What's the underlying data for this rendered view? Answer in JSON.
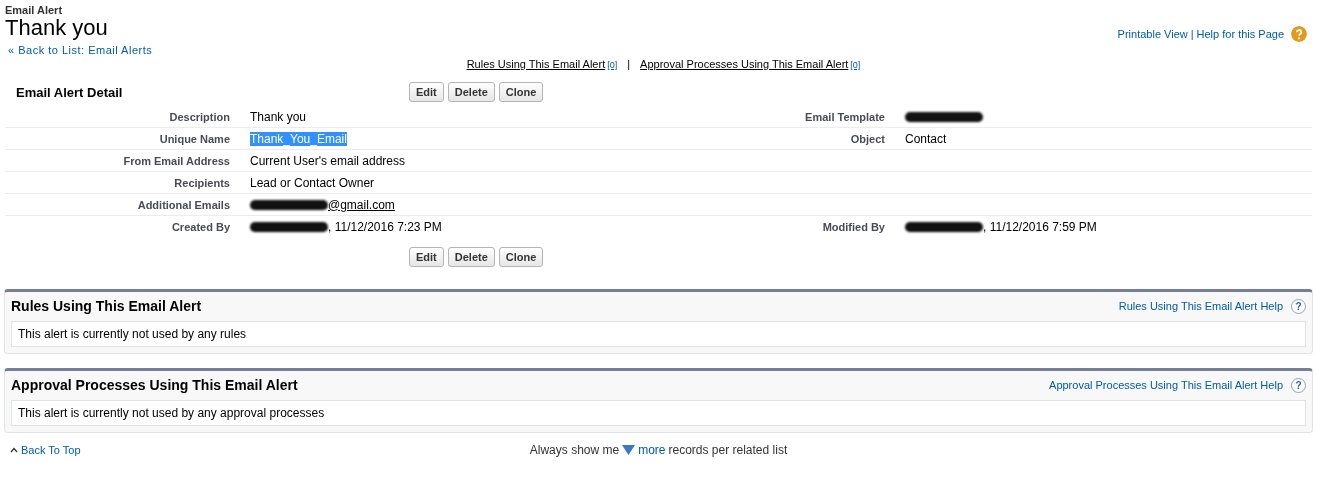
{
  "header": {
    "type_label": "Email Alert",
    "title": "Thank you",
    "back_link": "« Back to List: Email Alerts"
  },
  "top_links": {
    "items": [
      "Printable View",
      "Help for this Page"
    ],
    "separator": "|"
  },
  "related_links": {
    "items": [
      {
        "label": "Rules Using This Email Alert",
        "count": "[0]"
      },
      {
        "label": "Approval Processes Using This Email Alert",
        "count": "[0]"
      }
    ],
    "separator": "|"
  },
  "detail": {
    "title": "Email Alert Detail",
    "buttons": [
      "Edit",
      "Delete",
      "Clone"
    ],
    "rows": [
      {
        "left": {
          "label": "Description",
          "value": "Thank you",
          "kind": "text"
        },
        "right": {
          "label": "Email Template",
          "kind": "redacted"
        }
      },
      {
        "left": {
          "label": "Unique Name",
          "value": "Thank_You_Email",
          "kind": "selected"
        },
        "right": {
          "label": "Object",
          "value": "Contact",
          "kind": "text"
        }
      },
      {
        "left": {
          "label": "From Email Address",
          "value": "Current User's email address",
          "kind": "text"
        }
      },
      {
        "left": {
          "label": "Recipients",
          "value": "Lead or Contact Owner",
          "kind": "text"
        }
      },
      {
        "left": {
          "label": "Additional Emails",
          "value": "@gmail.com",
          "kind": "redacted_link"
        }
      },
      {
        "left": {
          "label": "Created By",
          "value": ", 11/12/2016 7:23 PM",
          "kind": "redacted_text"
        },
        "right": {
          "label": "Modified By",
          "value": ", 11/12/2016 7:59 PM",
          "kind": "redacted_text"
        }
      }
    ],
    "bottom_buttons": [
      "Edit",
      "Delete",
      "Clone"
    ]
  },
  "related_lists": [
    {
      "title": "Rules Using This Email Alert",
      "help_link": "Rules Using This Email Alert Help",
      "help_icon": "?",
      "message": "This alert is currently not used by any rules"
    },
    {
      "title": "Approval Processes Using This Email Alert",
      "help_link": "Approval Processes Using This Email Alert Help",
      "help_icon": "?",
      "message": "This alert is currently not used by any approval processes"
    }
  ],
  "footer": {
    "back_to_top": "Back To Top",
    "show_prefix": "Always show me",
    "more": "more",
    "show_suffix": "records per related list"
  }
}
